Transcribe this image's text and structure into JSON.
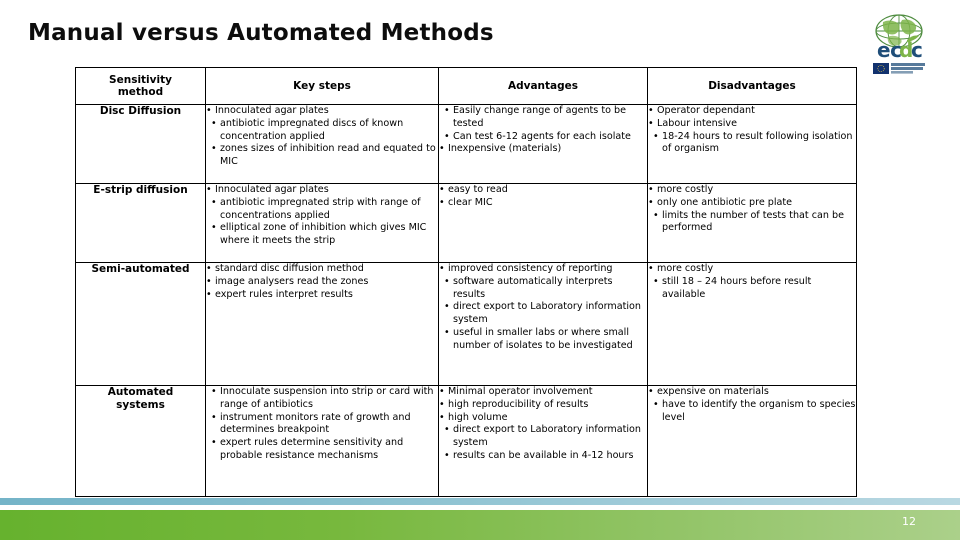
{
  "slide": {
    "title": "Manual versus Automated Methods",
    "page_number": "12",
    "accent_teal": "#8FC3D2",
    "accent_green": "#66B22E"
  },
  "logo": {
    "name": "ecdc-logo",
    "wordmark": "ecdc",
    "eu_badge_line1": "EUROPEAN CENTRE FOR",
    "eu_badge_line2": "DISEASE PREVENTION",
    "eu_badge_line3": "AND CONTROL",
    "globe_color": "#5BA24B",
    "wordmark_color": "#1F4E79",
    "wordmark_accent_color": "#7DB449"
  },
  "table": {
    "headers": [
      "Sensitivity method",
      "Key steps",
      "Advantages",
      "Disadvantages"
    ],
    "header_lines": {
      "method_line1": "Sensitivity",
      "method_line2": "method"
    },
    "rows": [
      {
        "method": "Disc Diffusion",
        "method_lines": [
          "Disc Diffusion"
        ],
        "key_steps": [
          "Innoculated agar plates",
          "antibiotic impregnated discs of known concentration applied",
          "zones sizes of inhibition read and equated to MIC"
        ],
        "advantages": [
          "Easily change range of agents to be tested",
          "Can test 6-12 agents for each isolate",
          "Inexpensive (materials)"
        ],
        "disadvantages": [
          "Operator dependant",
          "Labour intensive",
          "18-24 hours to result following isolation of organism"
        ]
      },
      {
        "method": "E-strip diffusion",
        "method_lines": [
          "E-strip diffusion"
        ],
        "key_steps": [
          "Innoculated agar plates",
          "antibiotic impregnated strip with range of concentrations applied",
          "elliptical zone of inhibition which gives MIC where it meets the strip"
        ],
        "advantages": [
          "easy to read",
          "clear MIC"
        ],
        "disadvantages": [
          "more costly",
          "only one antibiotic pre plate",
          "limits the number of tests  that can be performed"
        ]
      },
      {
        "method": "Semi-automated",
        "method_lines": [
          "Semi-automated"
        ],
        "key_steps": [
          "standard disc diffusion method",
          "image analysers read the zones",
          "expert rules interpret results"
        ],
        "advantages": [
          "improved consistency of reporting",
          "software automatically interprets results",
          "direct export to Laboratory information system",
          "useful in smaller labs or where small number of isolates  to be investigated"
        ],
        "disadvantages": [
          "more costly",
          "still 18 – 24 hours before result available"
        ]
      },
      {
        "method": "Automated systems",
        "method_lines": [
          "Automated",
          "systems"
        ],
        "key_steps": [
          "Innoculate suspension into strip or card with range of antibiotics",
          "instrument monitors rate of growth and determines breakpoint",
          "expert rules determine sensitivity and probable resistance mechanisms"
        ],
        "advantages": [
          "Minimal operator involvement",
          "high reproducibility of results",
          "high volume",
          "direct export to Laboratory information system",
          "results can be available in 4-12 hours"
        ],
        "disadvantages": [
          "expensive on materials",
          "have to identify the organism to species level"
        ]
      }
    ]
  }
}
